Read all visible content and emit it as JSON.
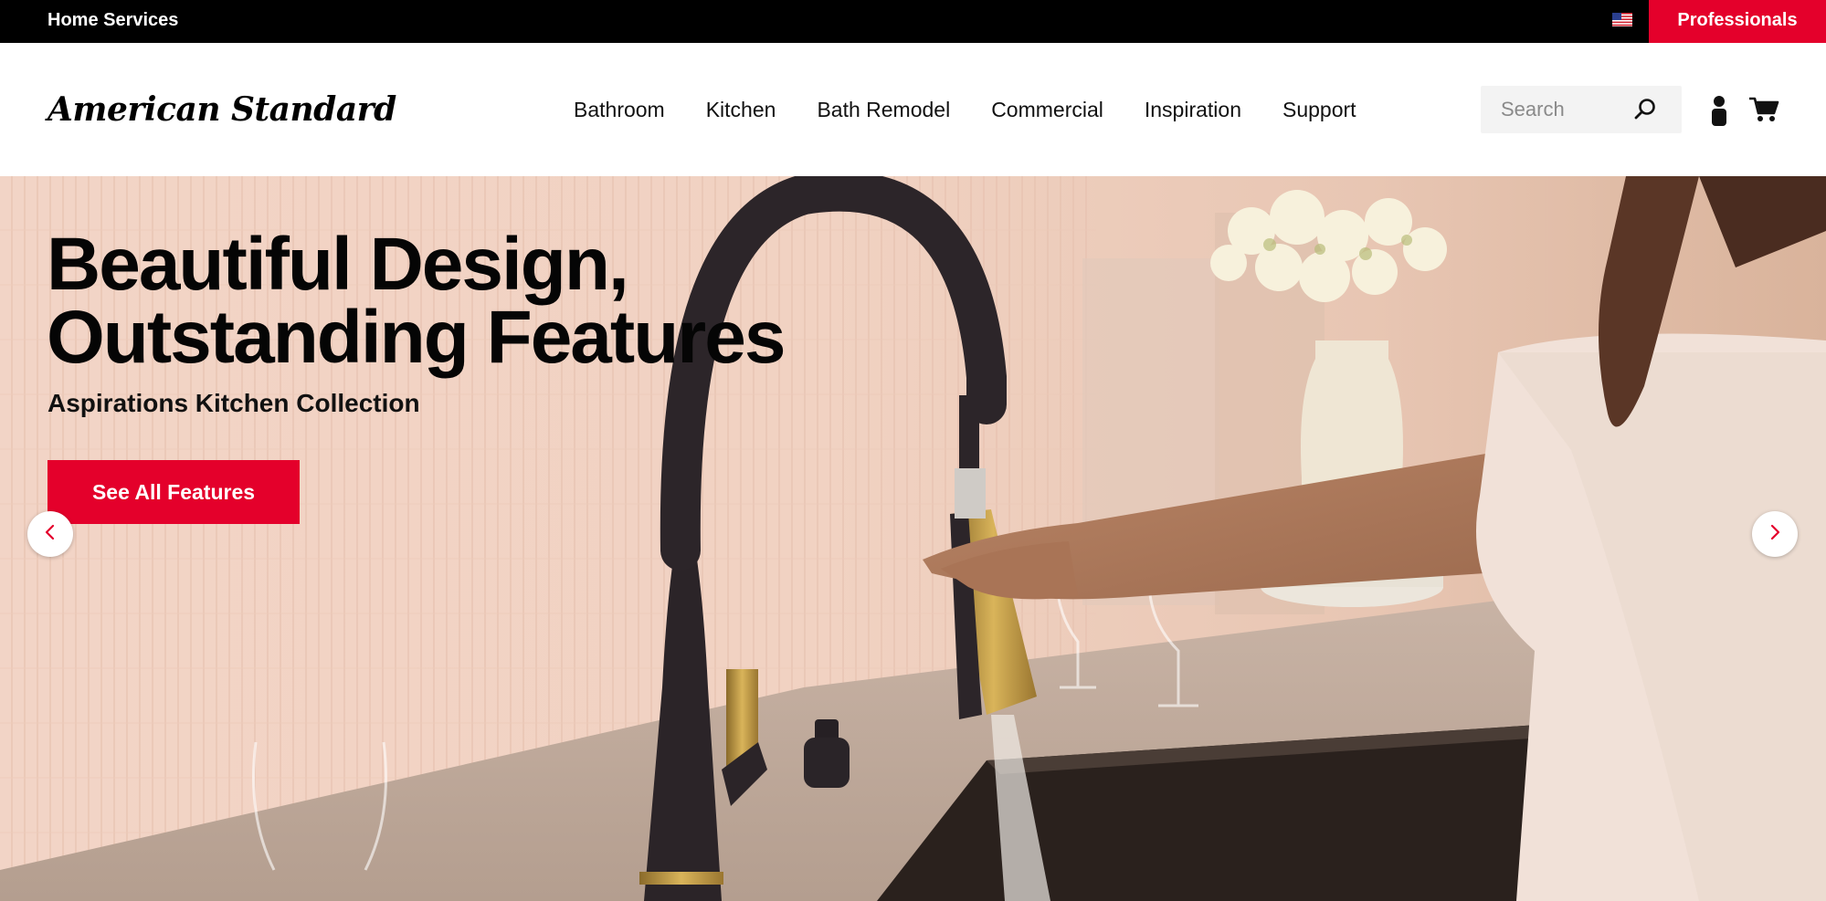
{
  "topbar": {
    "home_services": "Home Services",
    "professionals": "Professionals",
    "region_icon": "us-flag-icon"
  },
  "header": {
    "logo": "American Standard",
    "nav": [
      "Bathroom",
      "Kitchen",
      "Bath Remodel",
      "Commercial",
      "Inspiration",
      "Support"
    ],
    "search_placeholder": "Search",
    "icons": [
      "search-icon",
      "account-icon",
      "cart-icon"
    ]
  },
  "hero": {
    "title_line1": "Beautiful Design,",
    "title_line2": "Outstanding Features",
    "subtitle": "Aspirations Kitchen Collection",
    "cta": "See All Features",
    "prev_icon": "chevron-left-icon",
    "next_icon": "chevron-right-icon"
  },
  "colors": {
    "brand_red": "#e4002b",
    "topbar_bg": "#000000",
    "search_bg": "#f3f3f3"
  }
}
